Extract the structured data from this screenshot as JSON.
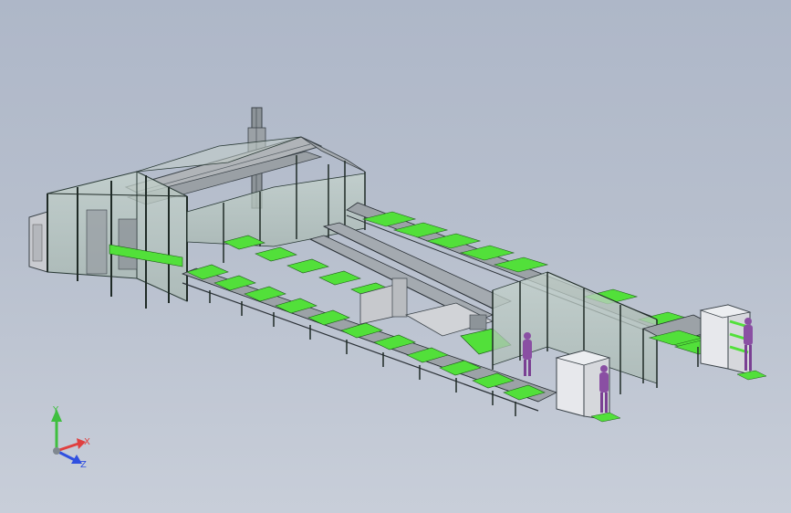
{
  "viewport": {
    "background_top": "#aeb7c8",
    "background_bottom": "#c8ced9"
  },
  "colors": {
    "frame_line": "#2a3a36",
    "guard_panel": "#b9c9c2",
    "tray_green": "#52e03a",
    "conveyor_top": "#8f969c",
    "operator": "#8a4fa3",
    "cabinet": "#e7e8ec"
  },
  "triad": {
    "y_label": "Y",
    "x_label": "X",
    "z_label": "Z",
    "y_color": "#3fbf3f",
    "x_color": "#e04040",
    "z_color": "#3050e0"
  }
}
